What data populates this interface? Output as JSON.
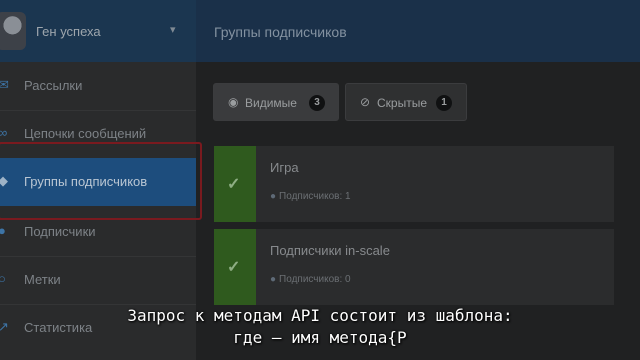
{
  "sidebar": {
    "account_name": "Ген успеха",
    "items": [
      {
        "label": "Рассылки",
        "icon": "envelope-icon"
      },
      {
        "label": "Цепочки сообщений",
        "icon": "link-icon"
      },
      {
        "label": "Группы подписчиков",
        "icon": "tags-icon",
        "active": true
      },
      {
        "label": "Подписчики",
        "icon": "users-icon"
      },
      {
        "label": "Метки",
        "icon": "circle-icon"
      },
      {
        "label": "Статистика",
        "icon": "chart-icon"
      }
    ]
  },
  "header": {
    "title": "Группы подписчиков"
  },
  "filters": [
    {
      "label": "Видимые",
      "icon": "eye-icon",
      "count": "3",
      "active": true
    },
    {
      "label": "Скрытые",
      "icon": "eye-slash-icon",
      "count": "1",
      "active": false
    }
  ],
  "groups": [
    {
      "name": "Игра",
      "meta": "Подписчиков: 1"
    },
    {
      "name": "Подписчики in-scale",
      "meta": "Подписчиков: 0"
    }
  ],
  "subtitles": {
    "line1": "Запрос к методам API состоит из шаблона:",
    "line2": "где  — имя метода{P"
  },
  "colors": {
    "header": "#1a3049",
    "active_item": "#1d4d7d",
    "highlight_outline": "#7a1a1f",
    "check_green": "#2f5a1e"
  }
}
